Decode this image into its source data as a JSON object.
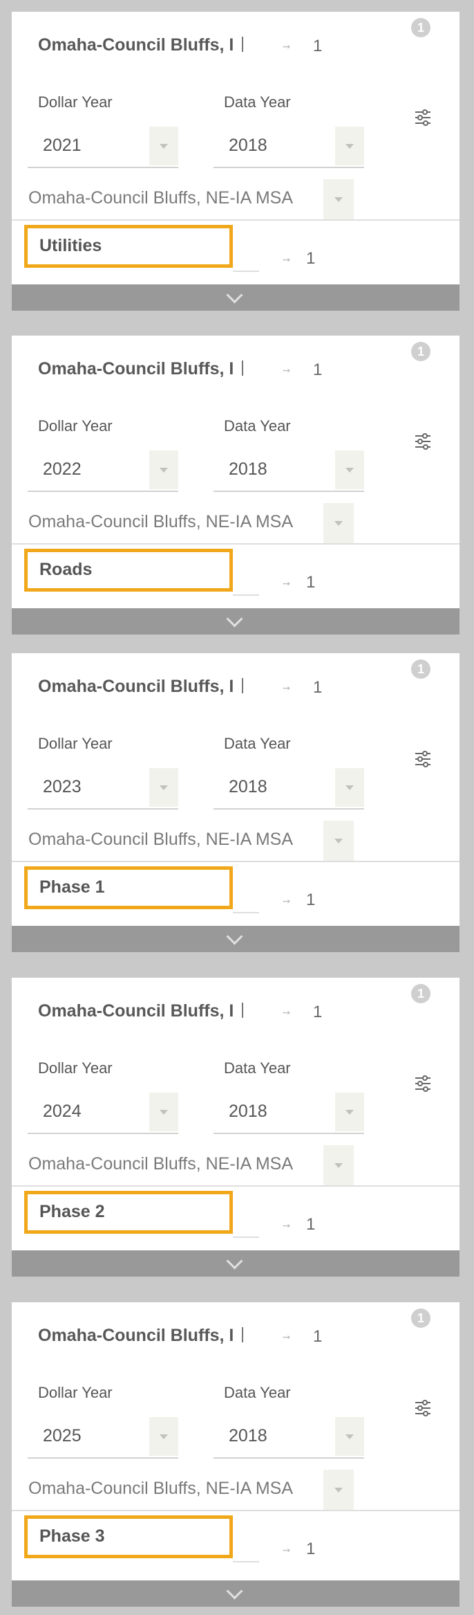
{
  "cards": [
    {
      "title": "Omaha-Council Bluffs, I",
      "title_count": "1",
      "info_badge": "1",
      "dollar_year_label": "Dollar Year",
      "dollar_year_value": "2021",
      "data_year_label": "Data Year",
      "data_year_value": "2018",
      "region_value": "Omaha-Council Bluffs, NE-IA MSA",
      "item_label": "Utilities",
      "item_count": "1"
    },
    {
      "title": "Omaha-Council Bluffs, I",
      "title_count": "1",
      "info_badge": "1",
      "dollar_year_label": "Dollar Year",
      "dollar_year_value": "2022",
      "data_year_label": "Data Year",
      "data_year_value": "2018",
      "region_value": "Omaha-Council Bluffs, NE-IA MSA",
      "item_label": "Roads",
      "item_count": "1"
    },
    {
      "title": "Omaha-Council Bluffs, I",
      "title_count": "1",
      "info_badge": "1",
      "dollar_year_label": "Dollar Year",
      "dollar_year_value": "2023",
      "data_year_label": "Data Year",
      "data_year_value": "2018",
      "region_value": "Omaha-Council Bluffs, NE-IA MSA",
      "item_label": "Phase 1",
      "item_count": "1"
    },
    {
      "title": "Omaha-Council Bluffs, I",
      "title_count": "1",
      "info_badge": "1",
      "dollar_year_label": "Dollar Year",
      "dollar_year_value": "2024",
      "data_year_label": "Data Year",
      "data_year_value": "2018",
      "region_value": "Omaha-Council Bluffs, NE-IA MSA",
      "item_label": "Phase 2",
      "item_count": "1"
    },
    {
      "title": "Omaha-Council Bluffs, I",
      "title_count": "1",
      "info_badge": "1",
      "dollar_year_label": "Dollar Year",
      "dollar_year_value": "2025",
      "data_year_label": "Data Year",
      "data_year_value": "2018",
      "region_value": "Omaha-Council Bluffs, NE-IA MSA",
      "item_label": "Phase 3",
      "item_count": "1"
    }
  ],
  "icons": {
    "info": "info-icon",
    "pin": "pin-icon",
    "filter": "filter-sliders-icon",
    "expand": "chevron-down-icon",
    "dropdown": "dropdown-arrow-icon"
  },
  "colors": {
    "highlight": "#f0a81a",
    "footer_bar": "#999999",
    "background": "#c9c9c9"
  }
}
